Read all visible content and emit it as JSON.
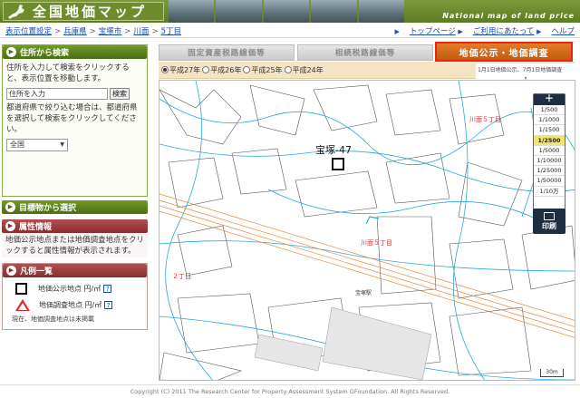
{
  "header": {
    "title": "全国地価マップ",
    "subtitle_en": "National map of land price"
  },
  "breadcrumb": {
    "items": [
      "表示位置設定",
      "兵庫県",
      "宝塚市",
      "川面",
      "5丁目"
    ],
    "separator": ">"
  },
  "top_links": {
    "top": "トップページ",
    "usage": "ご利用にあたって",
    "help": "ヘルプ"
  },
  "sidebar": {
    "address": {
      "title": "住所から検索",
      "desc1": "住所を入力して検索をクリックすると、表示位置を移動します。",
      "input_value": "住所を入力",
      "search_button": "検索",
      "desc2": "都道府県で絞り込む場合は、都道府県を選択して検索をクリックしてください。",
      "pref_selected": "全国"
    },
    "landmark": {
      "title": "目標物から選択"
    },
    "attribute": {
      "title": "属性情報",
      "desc": "地価公示地点または地価調査地点をクリックすると属性情報が表示されます。"
    },
    "legend": {
      "title": "凡例一覧",
      "items": [
        {
          "label": "地価公示地点 円/㎡",
          "icon": "square-icon"
        },
        {
          "label": "地価調査地点 円/㎡",
          "icon": "triangle-icon"
        }
      ],
      "note": "現在、地価調査地点は未掲載"
    }
  },
  "tabs": [
    {
      "label": "固定資産税路線価等"
    },
    {
      "label": "相続税路線価等"
    }
  ],
  "active_tab": "地価公示・地価調査",
  "years": [
    {
      "label": "平成27年",
      "selected": true
    },
    {
      "label": "平成26年",
      "selected": false
    },
    {
      "label": "平成25年",
      "selected": false
    },
    {
      "label": "平成24年",
      "selected": false
    }
  ],
  "date_note": "1月1日地価公示、7月1日地価調査",
  "map": {
    "point_label": "宝塚-47",
    "place_labels": {
      "kawamo_5": "川面５丁目",
      "kawamo_5b": "川面５丁目",
      "chome2": "２丁目"
    },
    "station_label": "宝塚駅"
  },
  "zoom": {
    "levels": [
      "1/500",
      "1/1000",
      "1/1500",
      "1/2500",
      "1/5000",
      "1/10000",
      "1/25000",
      "1/50000",
      "1/10万"
    ],
    "selected": "1/2500",
    "print_label": "印刷"
  },
  "scale_label": "30m",
  "footer": "Copyright (C) 2011 The Research Center for Property Assessment System GFoundation. All Rights Reserved."
}
